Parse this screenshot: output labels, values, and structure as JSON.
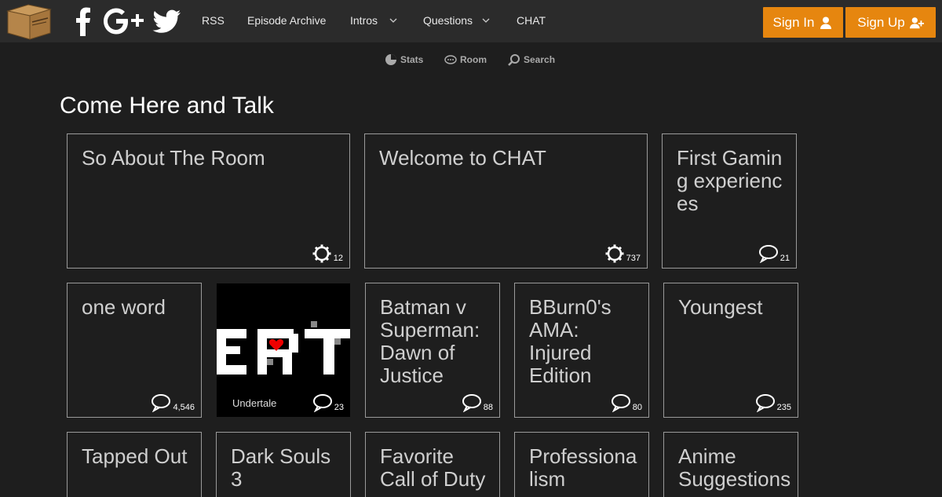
{
  "nav": {
    "social": [
      "facebook-icon",
      "google-plus-icon",
      "twitter-icon"
    ],
    "links": [
      {
        "label": "RSS"
      },
      {
        "label": "Episode Archive"
      },
      {
        "label": "Intros"
      },
      {
        "label": "Questions"
      },
      {
        "label": "CHAT"
      }
    ],
    "sign_in": "Sign In",
    "sign_up": "Sign Up",
    "accent": "#e6860f"
  },
  "subnav": {
    "stats": "Stats",
    "room": "Room",
    "search": "Search"
  },
  "page_title": "Come Here and Talk",
  "tiles": [
    {
      "title": "So About The Room",
      "count": "12",
      "icon": "gear-icon"
    },
    {
      "title": "Welcome to CHAT",
      "count": "737",
      "icon": "gear-icon"
    },
    {
      "title": "First Gaming experiences",
      "count": "21",
      "icon": "speech-bubble-icon"
    },
    {
      "title": "one word",
      "count": "4,546",
      "icon": "speech-bubble-icon"
    },
    {
      "title": "Undertale",
      "count": "23",
      "icon": "speech-bubble-icon"
    },
    {
      "title": "Batman v Superman: Dawn of Justice",
      "count": "88",
      "icon": "speech-bubble-icon"
    },
    {
      "title": "BBurn0's AMA: Injured Edition",
      "count": "80",
      "icon": "speech-bubble-icon"
    },
    {
      "title": "Youngest",
      "count": "235",
      "icon": "speech-bubble-icon"
    },
    {
      "title": "Tapped Out",
      "count": "",
      "icon": ""
    },
    {
      "title": "Dark Souls 3",
      "count": "",
      "icon": ""
    },
    {
      "title": "Favorite Call of Duty",
      "count": "",
      "icon": ""
    },
    {
      "title": "Professionalism",
      "count": "",
      "icon": ""
    },
    {
      "title": "Anime Suggestions",
      "count": "",
      "icon": ""
    }
  ]
}
